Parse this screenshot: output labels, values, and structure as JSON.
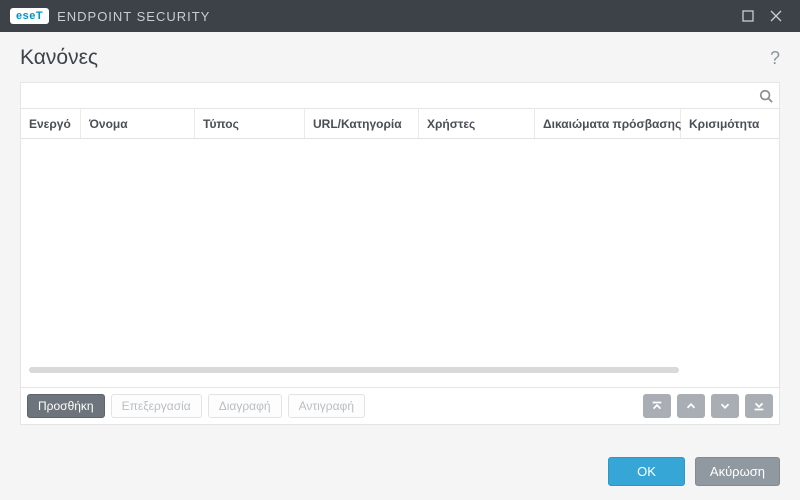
{
  "titlebar": {
    "logo_text": "eseT",
    "app_name": "ENDPOINT SECURITY"
  },
  "page": {
    "title": "Κανόνες",
    "help_glyph": "?"
  },
  "search": {
    "value": "",
    "placeholder": ""
  },
  "columns": {
    "active": "Ενεργό",
    "name": "Όνομα",
    "type": "Τύπος",
    "url": "URL/Κατηγορία",
    "users": "Χρήστες",
    "perm": "Δικαιώματα πρόσβασης",
    "crit": "Κρισιμότητα"
  },
  "rows": [],
  "actions": {
    "add": "Προσθήκη",
    "edit": "Επεξεργασία",
    "delete": "Διαγραφή",
    "copy": "Αντιγραφή"
  },
  "footer": {
    "ok": "OK",
    "cancel": "Ακύρωση"
  }
}
